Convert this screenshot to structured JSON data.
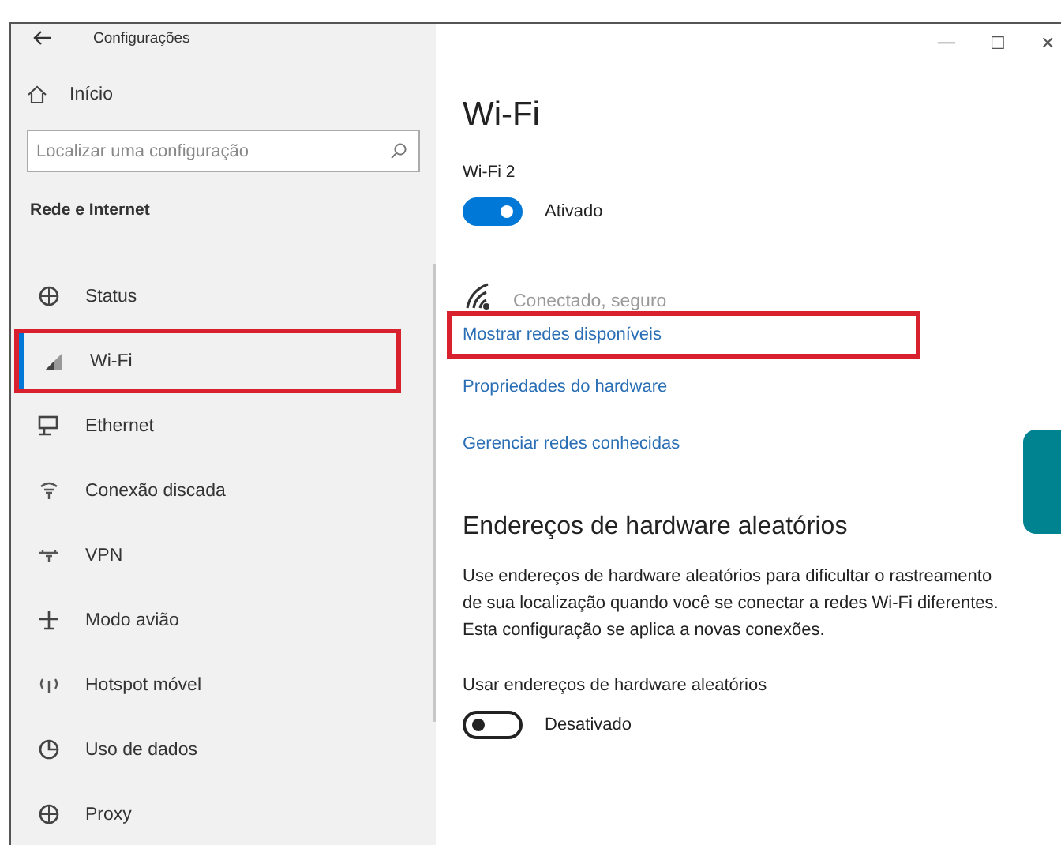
{
  "window": {
    "title": "Configurações",
    "controls": [
      "—",
      "☐",
      "✕"
    ]
  },
  "sidebar": {
    "home": {
      "label": "Início",
      "kind": "home"
    },
    "search": {
      "placeholder": "Localizar uma configuração"
    },
    "section": "Rede e Internet",
    "items": [
      {
        "label": "Status",
        "kind": "globe",
        "selected": false,
        "highlighted": false
      },
      {
        "label": "Wi-Fi",
        "kind": "wifi",
        "selected": true,
        "highlighted": true
      },
      {
        "label": "Ethernet",
        "kind": "monitor",
        "selected": false,
        "highlighted": false
      },
      {
        "label": "Conexão discada",
        "kind": "phone",
        "selected": false,
        "highlighted": false
      },
      {
        "label": "VPN",
        "kind": "vpn",
        "selected": false,
        "highlighted": false
      },
      {
        "label": "Modo avião",
        "kind": "plane",
        "selected": false,
        "highlighted": false
      },
      {
        "label": "Hotspot móvel",
        "kind": "hotspot",
        "selected": false,
        "highlighted": false
      },
      {
        "label": "Uso de dados",
        "kind": "chart",
        "selected": false,
        "highlighted": false
      },
      {
        "label": "Proxy",
        "kind": "globe",
        "selected": false,
        "highlighted": false
      }
    ]
  },
  "main": {
    "title": "Wi-Fi",
    "adapter": {
      "label": "Wi-Fi 2",
      "toggle": {
        "on": true,
        "label": "Ativado"
      }
    },
    "connection": {
      "status": "Conectado, seguro"
    },
    "links": [
      {
        "label": "Mostrar redes disponíveis",
        "highlighted": true
      },
      {
        "label": "Propriedades do hardware",
        "highlighted": false
      },
      {
        "label": "Gerenciar redes conhecidas",
        "highlighted": false
      }
    ],
    "random_hw": {
      "heading": "Endereços de hardware aleatórios",
      "description": "Use endereços de hardware aleatórios para dificultar o rastreamento de sua localização quando você se conectar a redes Wi-Fi diferentes. Esta configuração se aplica a novas conexões.",
      "setting_label": "Usar endereços de hardware aleatórios",
      "toggle": {
        "on": false,
        "label": "Desativado"
      }
    }
  }
}
